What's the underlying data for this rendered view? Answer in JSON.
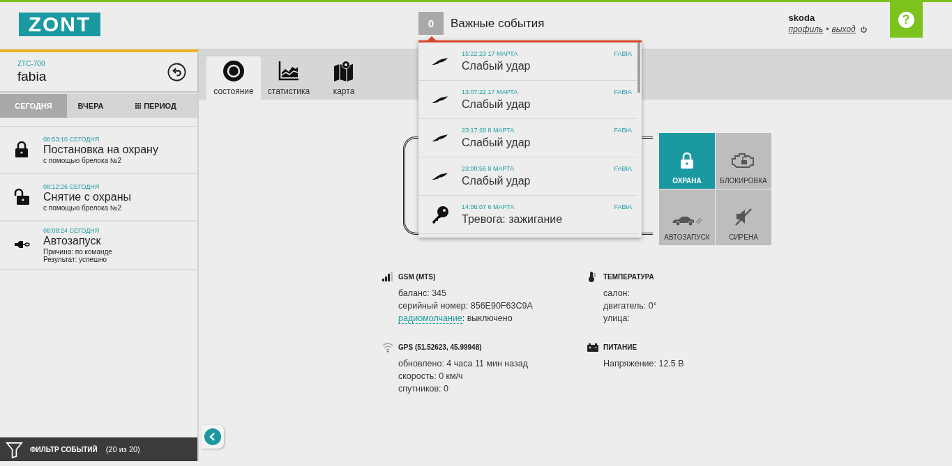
{
  "header": {
    "logo": "ZONT",
    "events_counter": "0",
    "events_label": "Важные события",
    "user": {
      "name": "skoda",
      "profile_link": "профиль",
      "separator": "•",
      "logout_link": "выход"
    },
    "help_button": "?"
  },
  "device": {
    "model": "ZTC-700",
    "name": "fabia"
  },
  "period_tabs": [
    {
      "label": "СЕГОДНЯ",
      "selected": true
    },
    {
      "label": "ВЧЕРА",
      "selected": false
    },
    {
      "label": "ПЕРИОД",
      "selected": false,
      "kind": "period"
    }
  ],
  "events": [
    {
      "kind": "lock",
      "time": "08:53:10 СЕГОДНЯ",
      "title": "Постановка на охрану",
      "details": [
        "с помощью брелока №2"
      ]
    },
    {
      "kind": "unlock",
      "time": "08:12:26 СЕГОДНЯ",
      "title": "Снятие с охраны",
      "details": [
        "с помощью брелока №2"
      ]
    },
    {
      "kind": "autostart",
      "time": "08:08:24 СЕГОДНЯ",
      "title": "Автозапуск",
      "details": [
        "Причина: по команде",
        "Результат: успешно"
      ]
    }
  ],
  "filter": {
    "label": "ФИЛЬТР СОБЫТИЙ",
    "count": "(20 из 20)"
  },
  "view_tabs": [
    {
      "kind": "status",
      "label": "состояние",
      "selected": true
    },
    {
      "kind": "stats",
      "label": "статистика",
      "selected": false
    },
    {
      "kind": "map",
      "label": "карта",
      "selected": false
    }
  ],
  "notifications": [
    {
      "kind": "shock",
      "time": "15:22:23 17 МАРТА",
      "device": "FABIA",
      "title": "Слабый удар"
    },
    {
      "kind": "shock",
      "time": "13:07:22 17 МАРТА",
      "device": "FABIA",
      "title": "Слабый удар"
    },
    {
      "kind": "shock",
      "time": "23:17:28 8 МАРТА",
      "device": "FABIA",
      "title": "Слабый удар"
    },
    {
      "kind": "shock",
      "time": "23:00:56 8 МАРТА",
      "device": "FABIA",
      "title": "Слабый удар"
    },
    {
      "kind": "key",
      "time": "14:06:07 6 МАРТА",
      "device": "FABIA",
      "title": "Тревога: зажигание"
    }
  ],
  "controls": [
    {
      "kind": "guard",
      "label": "ОХРАНА",
      "selected": true
    },
    {
      "kind": "block",
      "label": "БЛОКИРОВКА",
      "selected": false
    },
    {
      "kind": "autostart",
      "label": "АВТОЗАПУСК",
      "selected": false
    },
    {
      "kind": "siren",
      "label": "СИРЕНА",
      "selected": false
    }
  ],
  "info_sections": [
    {
      "kind": "gsm",
      "title": "GSM (MTS)",
      "lines": [
        {
          "text": "баланс: 345"
        },
        {
          "text": "серийный номер: 856E90F63C9A"
        },
        {
          "link": "радиомолчание",
          "text": ": выключено"
        }
      ]
    },
    {
      "kind": "temperature",
      "title": "ТЕМПЕРАТУРА",
      "lines": [
        {
          "text": "салон:"
        },
        {
          "text": "двигатель: 0°"
        },
        {
          "text": "улица:"
        }
      ]
    },
    {
      "kind": "gps",
      "title": "GPS (51.52623, 45.99948)",
      "lines": [
        {
          "text": "обновлено: 4 часа 11 мин назад"
        },
        {
          "text": "скорость: 0 км/ч"
        },
        {
          "text": "спутников: 0"
        }
      ]
    },
    {
      "kind": "power",
      "title": "ПИТАНИЕ",
      "lines": [
        {
          "text": "Напряжение: 12.5 В"
        }
      ]
    }
  ]
}
